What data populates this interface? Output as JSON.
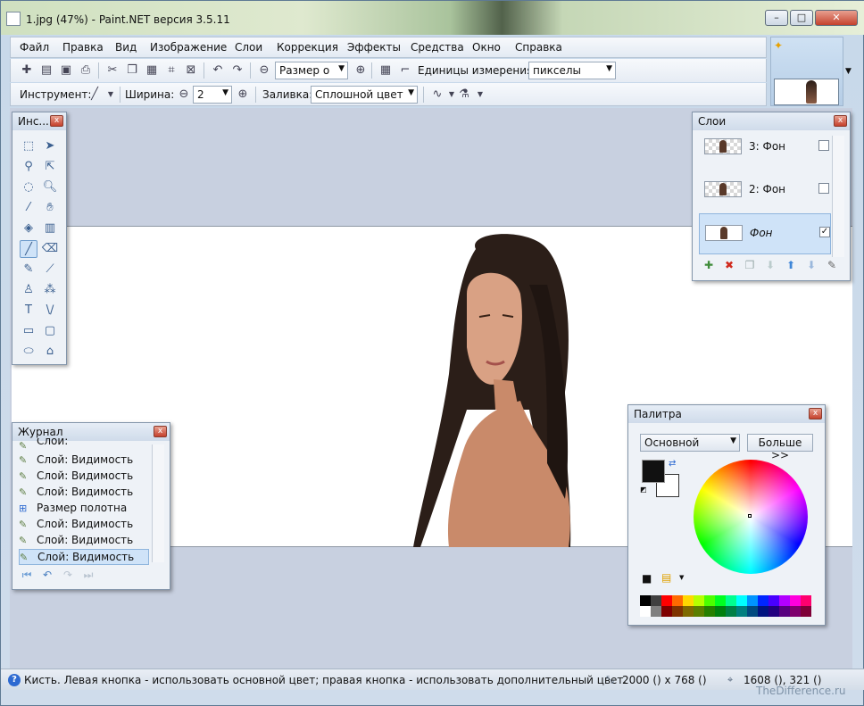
{
  "window": {
    "title": "1.jpg (47%) - Paint.NET версия 3.5.11",
    "minimize": "–",
    "restore": "□",
    "close": "✕"
  },
  "menu": [
    "Файл",
    "Правка",
    "Вид",
    "Изображение",
    "Слои",
    "Коррекция",
    "Эффекты",
    "Средства",
    "Окно",
    "Справка"
  ],
  "toolbar1": {
    "zoom_value": "Размер о",
    "units_label": "Единицы измерения:",
    "units_value": "пикселы"
  },
  "toolbar2": {
    "tool_label": "Инструмент:",
    "width_label": "Ширина:",
    "width_value": "2",
    "fill_label": "Заливка:",
    "fill_value": "Сплошной цвет"
  },
  "tools_panel": {
    "title": "Инс..."
  },
  "layers_panel": {
    "title": "Слои",
    "layers": [
      {
        "name": "3: Фон",
        "visible": false
      },
      {
        "name": "2: Фон",
        "visible": false
      },
      {
        "name": "Фон",
        "visible": true
      }
    ]
  },
  "history_panel": {
    "title": "Журнал",
    "items": [
      "Слой: Непрозрачность",
      "Слой: Видимость",
      "Слой: Видимость",
      "Слой: Видимость",
      "Размер полотна",
      "Слой: Видимость",
      "Слой: Видимость",
      "Слой: Видимость"
    ]
  },
  "palette_panel": {
    "title": "Палитра",
    "mode_value": "Основной",
    "more_button": "Больше >>",
    "primary": "#111111",
    "secondary": "#ffffff",
    "swatches_top": [
      "#000000",
      "#404040",
      "#ff0000",
      "#ff6a00",
      "#ffd800",
      "#b6ff00",
      "#4cff00",
      "#00ff21",
      "#00ff90",
      "#00ffff",
      "#0094ff",
      "#0026ff",
      "#4800ff",
      "#b200ff",
      "#ff00dc",
      "#ff006e"
    ],
    "swatches_bottom": [
      "#ffffff",
      "#808080",
      "#7f0000",
      "#7f3300",
      "#7f6a00",
      "#5b7f00",
      "#267f00",
      "#007f0e",
      "#007f46",
      "#007f7f",
      "#004a7f",
      "#00137f",
      "#21007f",
      "#57007f",
      "#7f006e",
      "#7f0037"
    ]
  },
  "status": {
    "hint": "Кисть. Левая кнопка - использовать основной цвет; правая кнопка - использовать дополнительный цвет.",
    "image_size": "2000 () x 768 ()",
    "cursor": "1608 (), 321 ()"
  },
  "watermark": "TheDifference.ru"
}
